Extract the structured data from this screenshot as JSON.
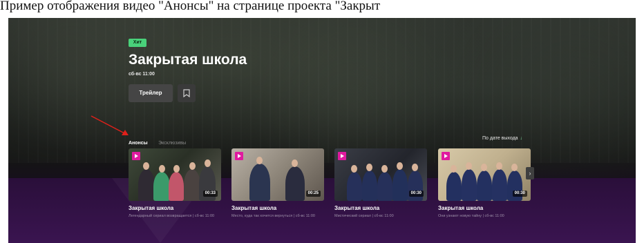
{
  "caption": "Пример отображения видео \"Анонсы\" на странице проекта \"Закрыт",
  "hero": {
    "badge": "Хит",
    "title": "Закрытая школа",
    "schedule": "сб-вс 11:00",
    "trailer_label": "Трейлер"
  },
  "tabs": [
    {
      "label": "Анонсы",
      "active": true
    },
    {
      "label": "Эксклюзивы",
      "active": false
    }
  ],
  "sort": {
    "label": "По дате выхода",
    "arrow": "↓"
  },
  "cards": [
    {
      "title": "Закрытая школа",
      "description": "Легендарный сериал возвращается | сб-вс 11:00",
      "duration": "00:33"
    },
    {
      "title": "Закрытая школа",
      "description": "Место, куда так хочется вернуться | сб-вс 11:00",
      "duration": "00:25"
    },
    {
      "title": "Закрытая школа",
      "description": "Мистический сериал | сб-вс 11:00",
      "duration": "00:30"
    },
    {
      "title": "Закрытая школа",
      "description": "Они узнают новую тайну | сб-вс 11:00",
      "duration": "00:30"
    }
  ],
  "next_icon": "chevron-right-icon",
  "colors": {
    "badge": "#49d17a",
    "play": "#e01a9f",
    "accent_arrow": "#7fe0a2",
    "annotation_arrow": "#e0201a"
  }
}
